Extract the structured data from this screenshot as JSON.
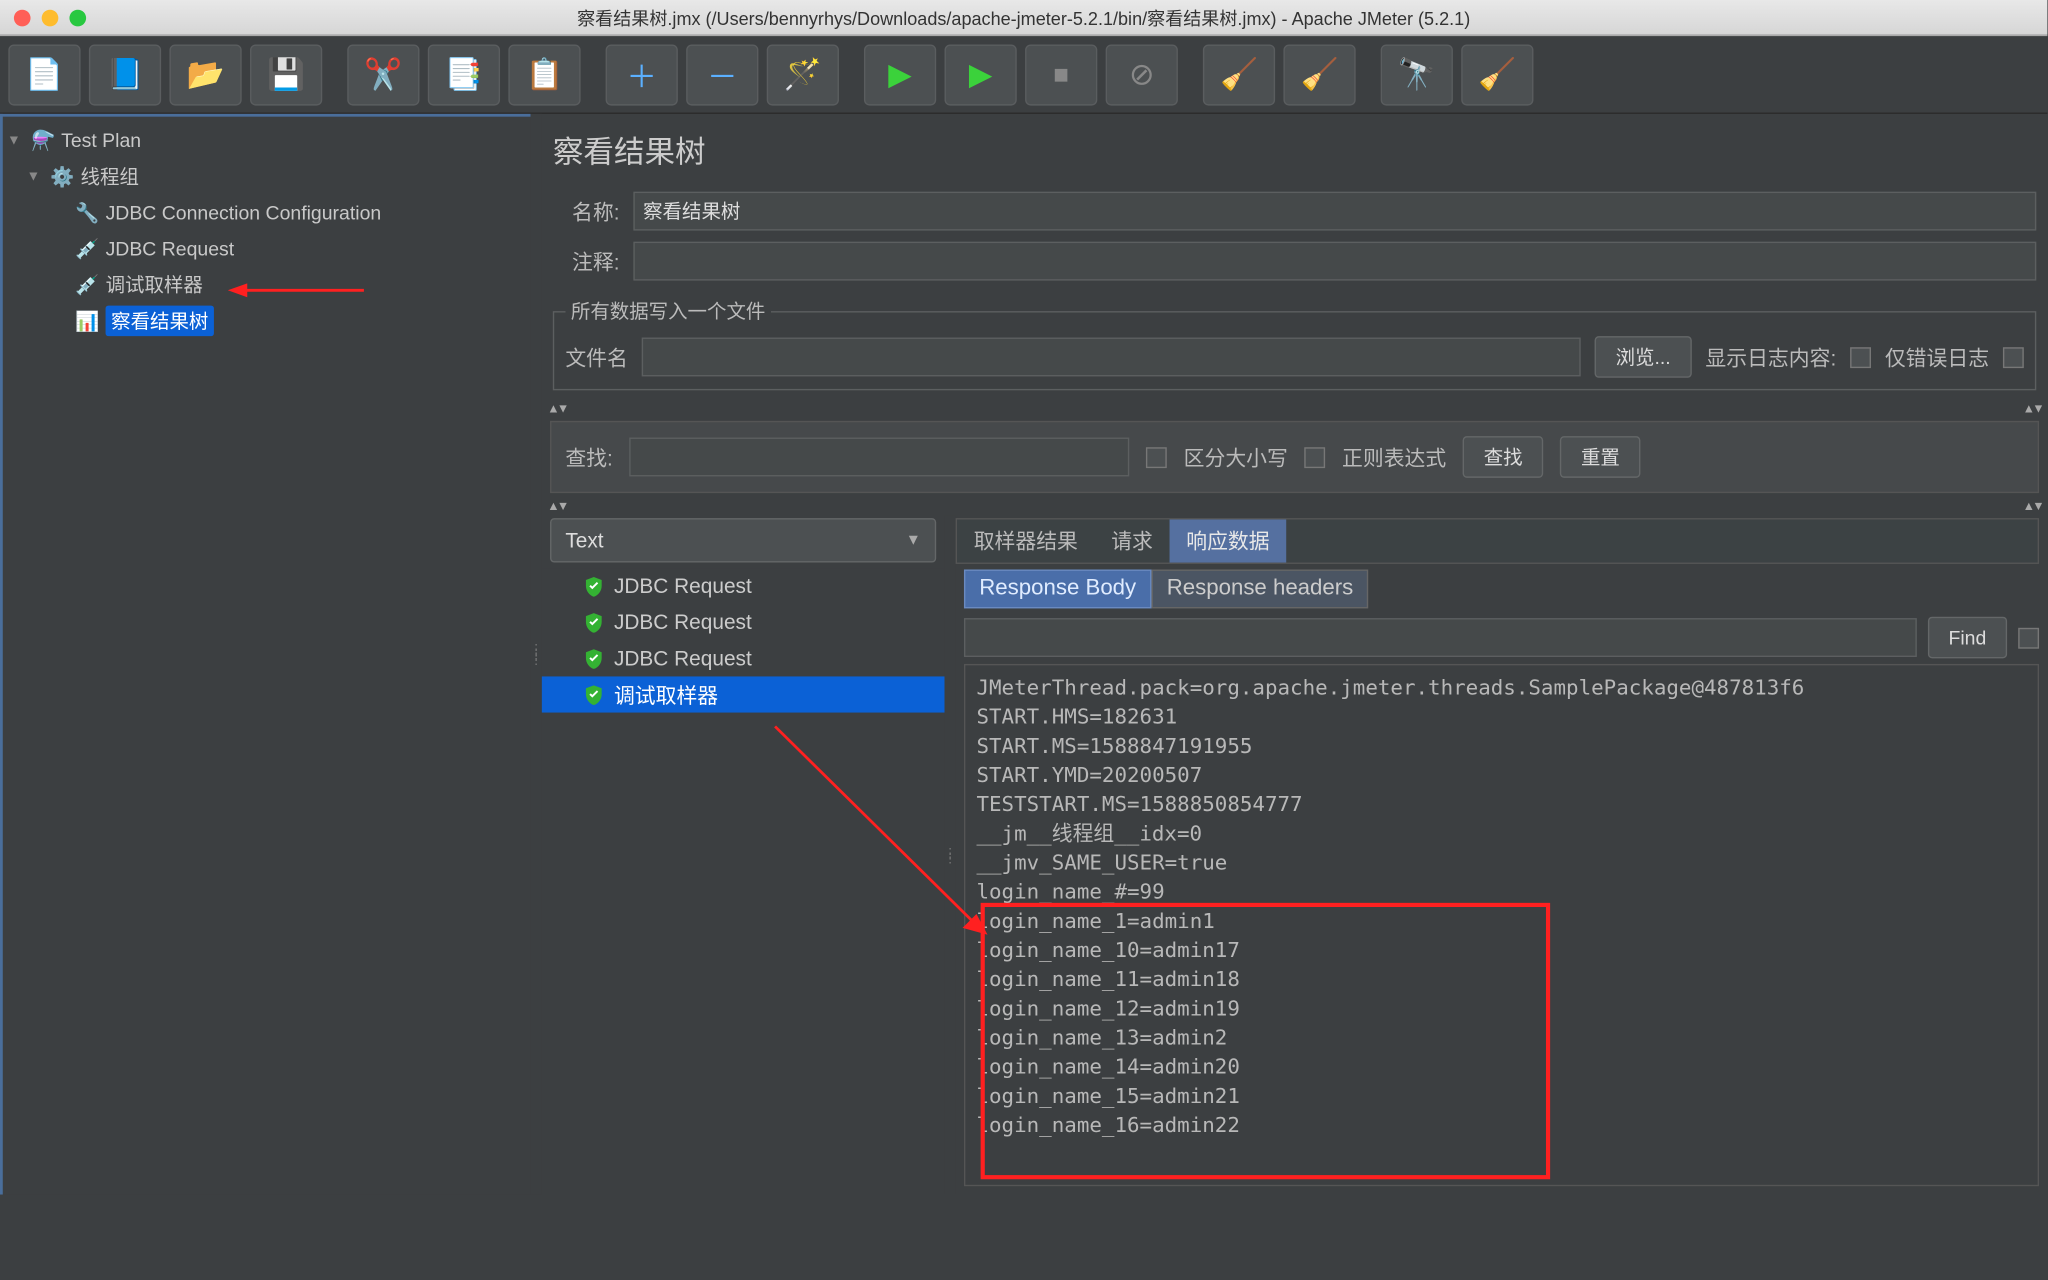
{
  "window": {
    "title": "察看结果树.jmx (/Users/bennyrhys/Downloads/apache-jmeter-5.2.1/bin/察看结果树.jmx) - Apache JMeter (5.2.1)"
  },
  "toolbar_icons": [
    "new",
    "templates",
    "open",
    "save",
    "cut",
    "copy",
    "paste",
    "plus",
    "minus",
    "wand",
    "run",
    "run-next",
    "stop",
    "shutdown",
    "clear",
    "clear-all",
    "search",
    "broom"
  ],
  "tree": {
    "root": "Test Plan",
    "group": "线程组",
    "items": [
      "JDBC Connection Configuration",
      "JDBC Request",
      "调试取样器"
    ],
    "selected": "察看结果树"
  },
  "panel": {
    "title": "察看结果树",
    "name_label": "名称:",
    "name_value": "察看结果树",
    "comment_label": "注释:",
    "comment_value": "",
    "file_legend": "所有数据写入一个文件",
    "file_label": "文件名",
    "file_value": "",
    "browse": "浏览...",
    "show_log_label": "显示日志内容:",
    "errors_only": "仅错误日志"
  },
  "search": {
    "label": "查找:",
    "value": "",
    "case_sensitive": "区分大小写",
    "regex": "正则表达式",
    "find_btn": "查找",
    "reset_btn": "重置"
  },
  "dropdown": "Text",
  "results": [
    {
      "label": "JDBC Request",
      "selected": false
    },
    {
      "label": "JDBC Request",
      "selected": false
    },
    {
      "label": "JDBC Request",
      "selected": false
    },
    {
      "label": "调试取样器",
      "selected": true
    }
  ],
  "tabs1": {
    "sampler": "取样器结果",
    "request": "请求",
    "response": "响应数据",
    "active": "响应数据"
  },
  "tabs2": {
    "body": "Response Body",
    "headers": "Response headers",
    "active": "Response Body"
  },
  "find": {
    "btn": "Find",
    "value": ""
  },
  "response_lines": [
    "JMeterThread.pack=org.apache.jmeter.threads.SamplePackage@487813f6",
    "START.HMS=182631",
    "START.MS=1588847191955",
    "START.YMD=20200507",
    "TESTSTART.MS=1588850854777",
    "__jm__线程组__idx=0",
    "__jmv_SAME_USER=true",
    "login_name_#=99",
    "login_name_1=admin1",
    "login_name_10=admin17",
    "login_name_11=admin18",
    "login_name_12=admin19",
    "login_name_13=admin2",
    "login_name_14=admin20",
    "login_name_15=admin21",
    "login_name_16=admin22"
  ]
}
